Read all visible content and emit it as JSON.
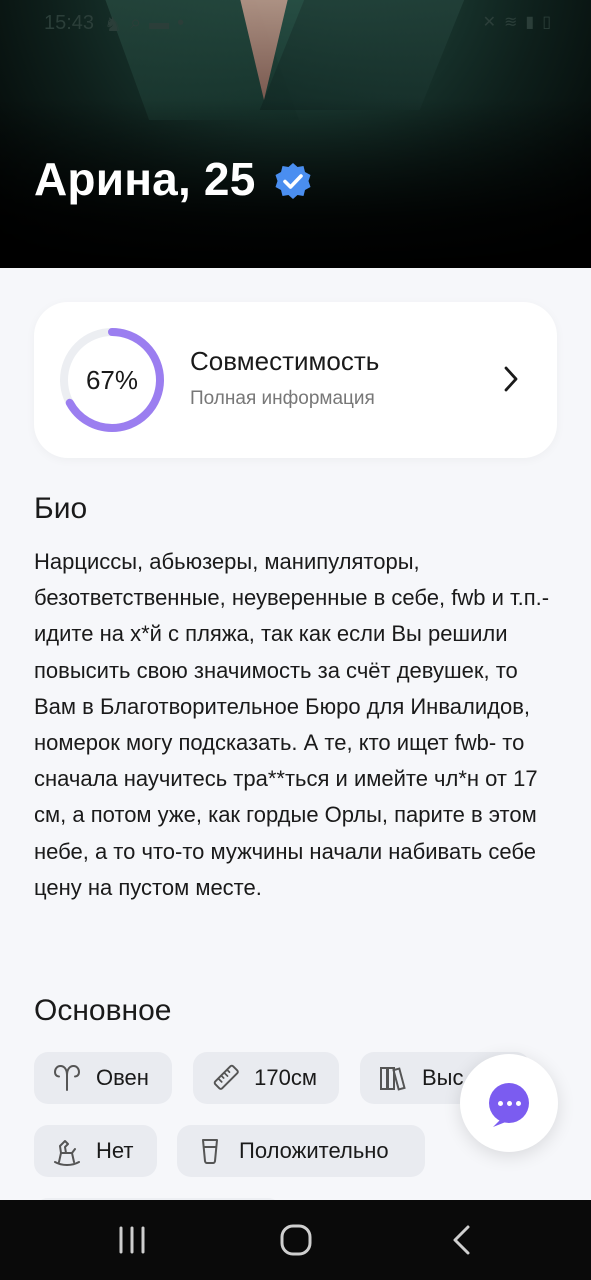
{
  "status_bar": {
    "time": "15:43",
    "left_icons": [
      "notification-icon",
      "search-icon",
      "message-icon",
      "dot-icon"
    ],
    "right_icons": [
      "mute-icon",
      "wifi-icon",
      "signal-icon",
      "battery-icon"
    ]
  },
  "profile": {
    "name_age": "Арина, 25",
    "verified": true
  },
  "compatibility": {
    "percent_label": "67%",
    "percent_value": 67,
    "title": "Совместимость",
    "subtitle": "Полная информация",
    "ring_color": "#9b7ef0",
    "track_color": "#eceef2"
  },
  "bio": {
    "title": "Био",
    "text": "Нарциссы, абьюзеры, манипуляторы, безответственные, неуверенные в себе, fwb и т.п.- идите на х*й с пляжа, так как если Вы решили повысить свою значимость за счёт девушек, то Вам в Благотворительное Бюро для Инвалидов, номерок могу подсказать. А те, кто ищет fwb- то сначала научитесь тра**ться и имейте чл*н от 17 см, а потом уже, как гордые Орлы, парите в этом небе, а то что-то мужчины начали набивать себе цену на пустом месте."
  },
  "basics": {
    "title": "Основное",
    "chips": [
      {
        "icon": "zodiac-aries-icon",
        "label": "Овен"
      },
      {
        "icon": "ruler-icon",
        "label": "170см"
      },
      {
        "icon": "books-icon",
        "label": "Выс"
      },
      {
        "icon": "rocking-horse-icon",
        "label": "Нет"
      },
      {
        "icon": "glass-icon",
        "label": "Положительно"
      }
    ]
  },
  "fab": {
    "icon": "chat-bubble-icon",
    "color": "#7b5cf0"
  },
  "nav_bar": {
    "buttons": [
      "recent-apps-icon",
      "home-icon",
      "back-icon"
    ]
  }
}
